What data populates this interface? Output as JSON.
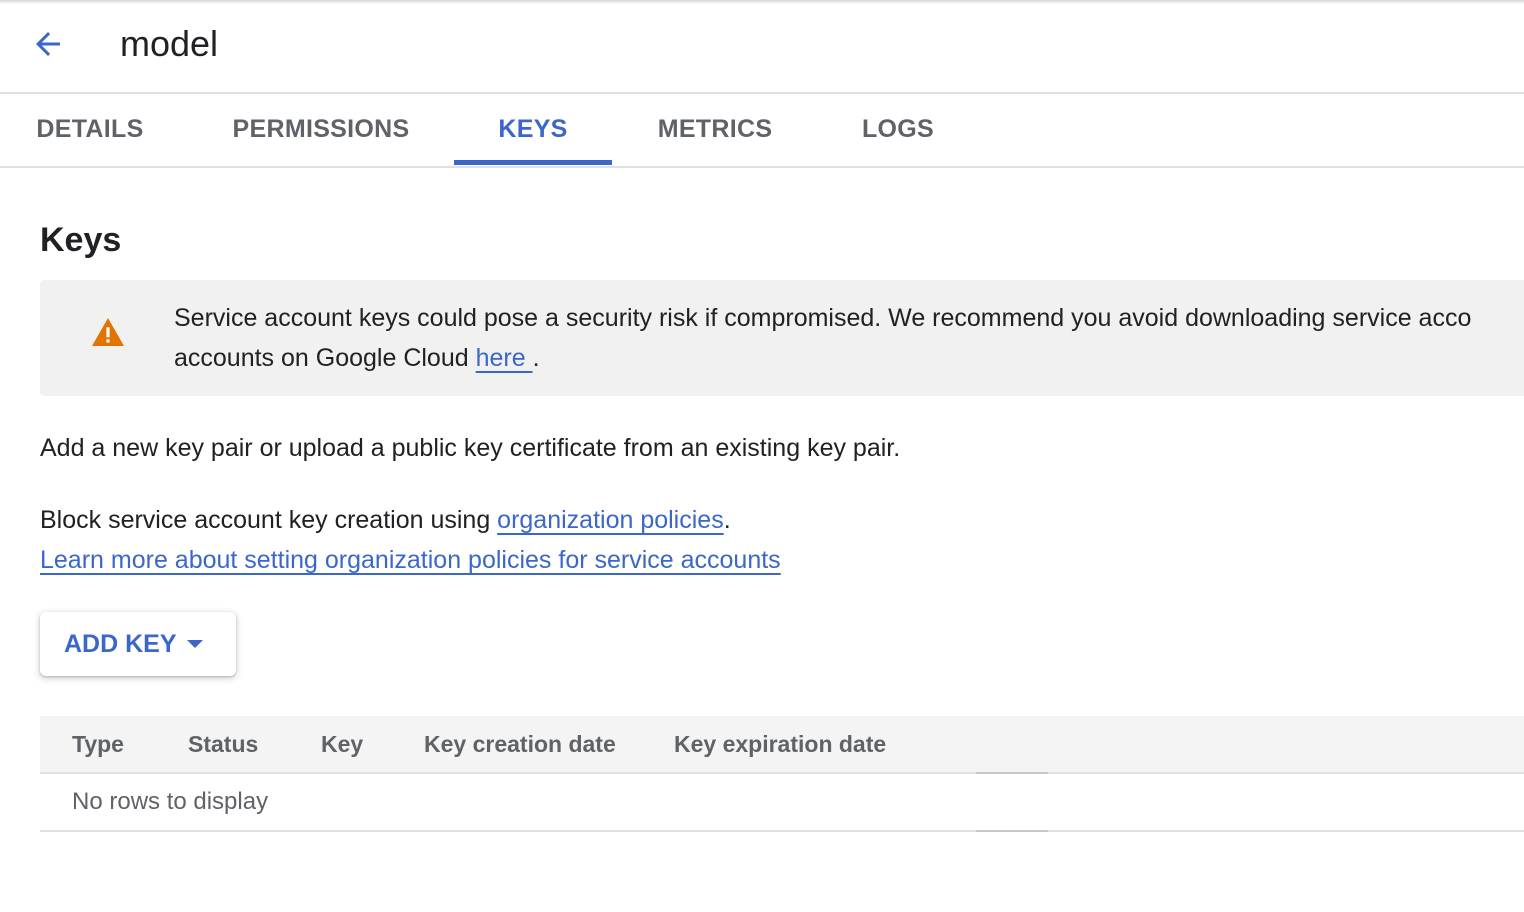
{
  "header": {
    "back_icon": "arrow-back-icon",
    "title": "model"
  },
  "tabs": [
    {
      "label": "DETAILS",
      "active": false
    },
    {
      "label": "PERMISSIONS",
      "active": false
    },
    {
      "label": "KEYS",
      "active": true
    },
    {
      "label": "METRICS",
      "active": false
    },
    {
      "label": "LOGS",
      "active": false
    }
  ],
  "section": {
    "title": "Keys"
  },
  "warning": {
    "icon": "warning-icon",
    "line1": "Service account keys could pose a security risk if compromised. We recommend you avoid downloading service acco",
    "line2_prefix": "accounts on Google Cloud ",
    "line2_link": "here ",
    "line2_suffix": "."
  },
  "description": "Add a new key pair or upload a public key certificate from an existing key pair.",
  "block": {
    "prefix": "Block service account key creation using ",
    "link": "organization policies",
    "suffix": "."
  },
  "learn_more_link": "Learn more about setting organization policies for service accounts",
  "add_key": {
    "label": "ADD KEY",
    "icon": "caret-down-icon"
  },
  "table": {
    "columns": [
      "Type",
      "Status",
      "Key",
      "Key creation date",
      "Key expiration date"
    ],
    "empty_message": "No rows to display"
  },
  "colors": {
    "accent": "#3b67c9",
    "warning": "#e37400",
    "text": "#202124",
    "muted": "#5f6368",
    "banner_bg": "#f1f1f1"
  }
}
